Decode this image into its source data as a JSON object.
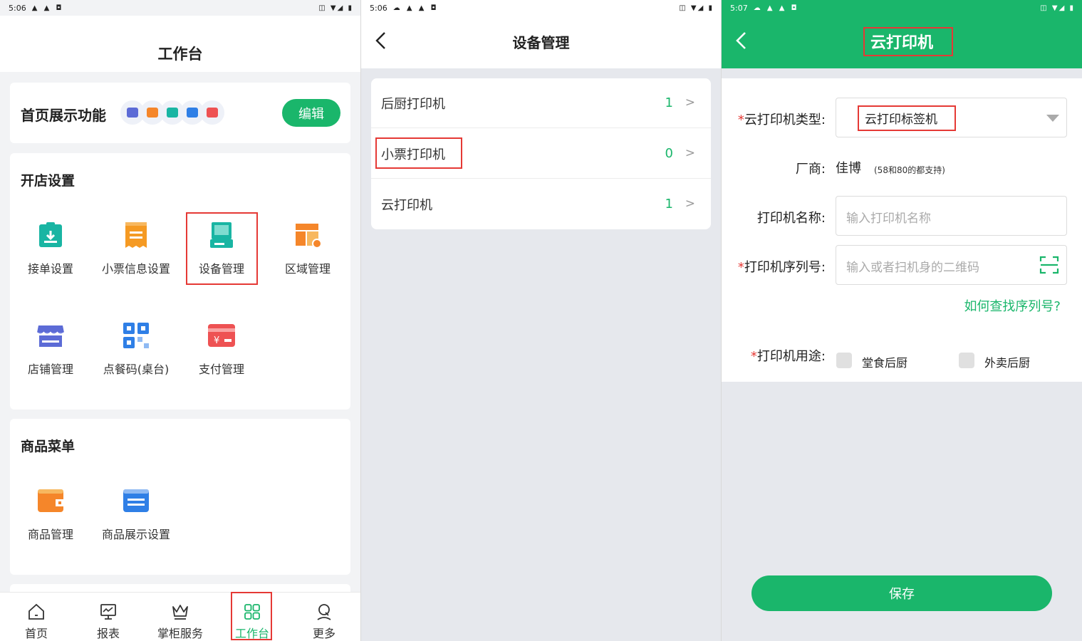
{
  "panel1": {
    "status": {
      "time": "5:06",
      "left_icons": "▲ ▲ ◘",
      "right_icons": "◫ ▼◢ ▮"
    },
    "title": "工作台",
    "feature_card": {
      "label": "首页展示功能",
      "edit_label": "编辑"
    },
    "open_store": {
      "title": "开店设置",
      "items": [
        {
          "label": "接单设置",
          "icon": "order-clipboard-icon",
          "color": "#19b5a3"
        },
        {
          "label": "小票信息设置",
          "icon": "receipt-icon",
          "color": "#f59a23"
        },
        {
          "label": "设备管理",
          "icon": "device-terminal-icon",
          "color": "#19b5a3"
        },
        {
          "label": "区域管理",
          "icon": "area-layout-icon",
          "color": "#f5862a"
        },
        {
          "label": "店铺管理",
          "icon": "store-icon",
          "color": "#5c6bd6"
        },
        {
          "label": "点餐码(桌台)",
          "icon": "qr-code-icon",
          "color": "#2f7fe6"
        },
        {
          "label": "支付管理",
          "icon": "payment-card-icon",
          "color": "#ee5253"
        }
      ]
    },
    "menu_section": {
      "title": "商品菜单",
      "items": [
        {
          "label": "商品管理",
          "icon": "wallet-icon",
          "color": "#f5862a"
        },
        {
          "label": "商品展示设置",
          "icon": "card-display-icon",
          "color": "#2f7fe6"
        }
      ]
    },
    "tabs": [
      {
        "label": "首页",
        "icon": "home-icon"
      },
      {
        "label": "报表",
        "icon": "chart-icon"
      },
      {
        "label": "掌柜服务",
        "icon": "crown-icon"
      },
      {
        "label": "工作台",
        "icon": "grid-icon"
      },
      {
        "label": "更多",
        "icon": "user-icon"
      }
    ],
    "active_tab": "工作台"
  },
  "panel2": {
    "status": {
      "time": "5:06",
      "left_icons": "☁ ▲ ▲ ◘",
      "right_icons": "◫ ▼◢ ▮"
    },
    "title": "设备管理",
    "rows": [
      {
        "label": "后厨打印机",
        "count": "1",
        "chevron": ">"
      },
      {
        "label": "小票打印机",
        "count": "0",
        "chevron": ">"
      },
      {
        "label": "云打印机",
        "count": "1",
        "chevron": ">"
      }
    ]
  },
  "panel3": {
    "status": {
      "time": "5:07",
      "left_icons": "☁ ▲ ▲ ◘",
      "right_icons": "◫ ▼◢ ▮"
    },
    "title": "云打印机",
    "type_label": "云打印机类型:",
    "type_value": "云打印标签机",
    "vendor_label": "厂商:",
    "vendor_value": "佳博",
    "vendor_note": "(58和80的都支持)",
    "name_label": "打印机名称:",
    "name_placeholder": "输入打印机名称",
    "serial_label": "打印机序列号:",
    "serial_placeholder": "输入或者扫机身的二维码",
    "help_link": "如何查找序列号?",
    "usage_label": "打印机用途:",
    "usage_options": [
      {
        "label": "堂食后厨",
        "checked": false
      },
      {
        "label": "外卖后厨",
        "checked": false
      }
    ],
    "required_mark": "*",
    "save_label": "保存"
  },
  "colors": {
    "accent": "#1ab66b",
    "highlight": "#e53935",
    "required": "#e53935"
  }
}
